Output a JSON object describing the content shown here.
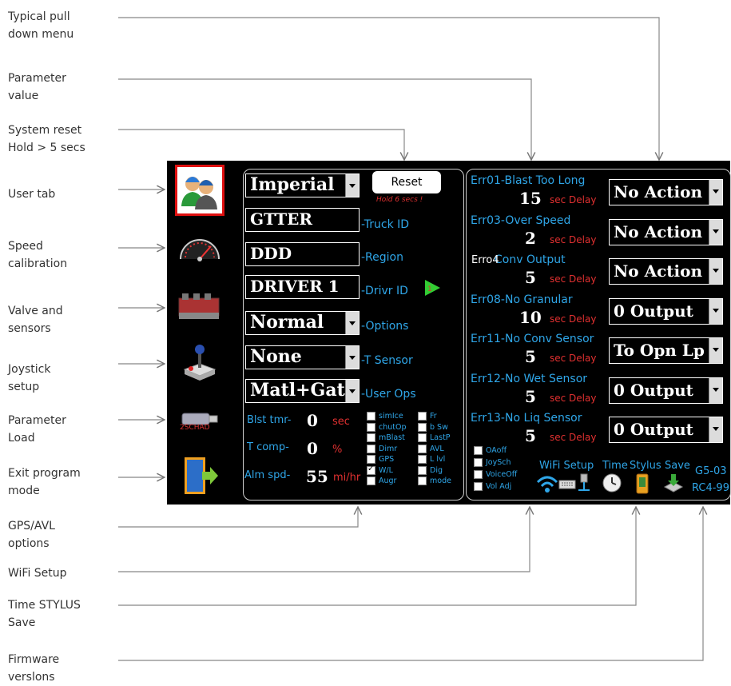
{
  "callouts": {
    "menu": "Typical pull\ndown menu",
    "param": "Parameter\nvalue",
    "reset": "System reset\nHold > 5 secs",
    "user": "User tab",
    "speed": "Speed\ncalibration",
    "valve": "Valve and\nsensors",
    "joystick": "Joystick\nsetup",
    "load": "Parameter\nLoad",
    "exit": "Exit program\nmode",
    "gps": "GPS/AVL\noptions",
    "wifi": "WiFi Setup",
    "time": "Time STYLUS\nSave",
    "firmware": "Firmware\nverslons"
  },
  "left": {
    "units": "Imperial",
    "reset_label": "Reset",
    "hold_note": "Hold 6 secs !",
    "truck_id": "GTTER",
    "truck_id_label": "-Truck ID",
    "region": "DDD",
    "region_label": "-Region",
    "driver_id": "DRIVER 1",
    "driver_id_label": "-Drivr ID",
    "play_num": "1",
    "options": "Normal",
    "options_label": "-Options",
    "t_sensor": "None",
    "t_sensor_label": "-T Sensor",
    "user_ops": "Matl+Gate",
    "user_ops_label": "-User Ops",
    "blast_label": "Blst tmr-",
    "blast_value": "0",
    "blast_unit": "sec",
    "tcomp_label": "T comp-",
    "tcomp_value": "0",
    "tcomp_unit": "%",
    "alm_label": "Alm spd-",
    "alm_value": "55",
    "alm_unit": "mi/hr",
    "load_icon_text": "2SCHAD",
    "checkboxes_a": [
      {
        "label": "simIce",
        "checked": false
      },
      {
        "label": "chutOp",
        "checked": false
      },
      {
        "label": "mBlast",
        "checked": false
      },
      {
        "label": "Dimr",
        "checked": false
      },
      {
        "label": "GPS",
        "checked": false
      },
      {
        "label": "W/L",
        "checked": true
      },
      {
        "label": "Augr",
        "checked": false
      }
    ],
    "checkboxes_b": [
      {
        "label": "Fr",
        "checked": false
      },
      {
        "label": "b Sw",
        "checked": false
      },
      {
        "label": "LastP",
        "checked": false
      },
      {
        "label": "AVL",
        "checked": false
      },
      {
        "label": "L lvl",
        "checked": false
      },
      {
        "label": "Dig",
        "checked": false
      },
      {
        "label": "mode",
        "checked": false
      }
    ]
  },
  "errors": [
    {
      "label": "Err01-Blast Too Long",
      "value": "15",
      "delay": "sec Delay",
      "action": "No Action"
    },
    {
      "label": "Err03-Over Speed",
      "value": "2",
      "delay": "sec Delay",
      "action": "No Action"
    },
    {
      "label_prefix": "Erro4",
      "label": "Conv Output",
      "value": "5",
      "delay": "sec Delay",
      "action": "No Action"
    },
    {
      "label": "Err08-No Granular",
      "value": "10",
      "delay": "sec Delay",
      "action": "0 Output"
    },
    {
      "label": "Err11-No Conv Sensor",
      "value": "5",
      "delay": "sec Delay",
      "action": "To Opn Lp"
    },
    {
      "label": "Err12-No Wet Sensor",
      "value": "5",
      "delay": "sec Delay",
      "action": "0 Output"
    },
    {
      "label": "Err13-No Liq Sensor",
      "value": "5",
      "delay": "sec Delay",
      "action": "0 Output"
    }
  ],
  "bottom_checks": [
    {
      "label": "OAoff",
      "checked": false
    },
    {
      "label": "JoySch",
      "checked": false
    },
    {
      "label": "VoiceOff",
      "checked": false
    },
    {
      "label": "Vol Adj",
      "checked": false
    }
  ],
  "bottom_labels": {
    "wifi": "WiFi Setup",
    "time": "Time",
    "stylus": "Stylus",
    "save": "Save",
    "fw1": "G5-03",
    "fw2": "RC4-99"
  },
  "colors": {
    "label_blue": "#2fa6e8",
    "delay_red": "#e03030",
    "selected_tab": "#e01010",
    "play_green": "#33cc33"
  }
}
